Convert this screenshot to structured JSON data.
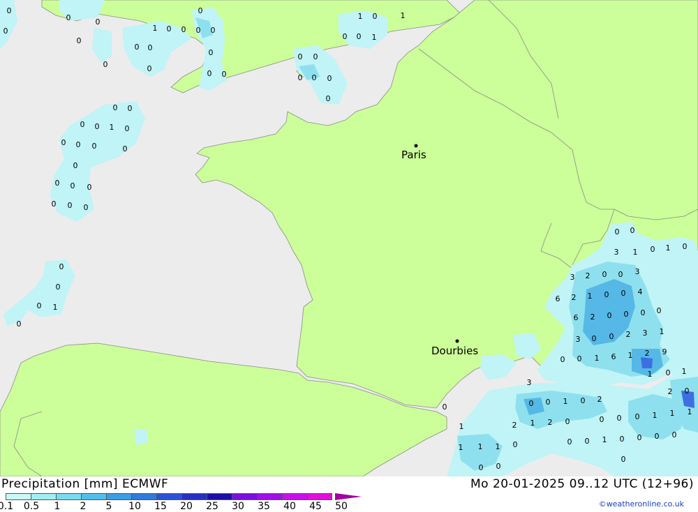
{
  "header": {
    "title_left": "Precipitation [mm] ECMWF",
    "title_right": "Mo 20-01-2025 09..12 UTC (12+96)"
  },
  "credit": "©weatheronline.co.uk",
  "colors": {
    "sea": "#ececec",
    "land": "#ccff99",
    "border": "#8a8a8a",
    "precip_light": "#c0f4f6",
    "precip_medium": "#8fe0ee",
    "precip_high": "#55b8e6",
    "precip_peak": "#3d6fe0"
  },
  "legend": {
    "ticks": [
      "0.1",
      "0.5",
      "1",
      "2",
      "5",
      "10",
      "15",
      "20",
      "25",
      "30",
      "35",
      "40",
      "45",
      "50"
    ],
    "colors": [
      "#c8f8f8",
      "#a0eef2",
      "#78dcee",
      "#50c0ea",
      "#3a9ee4",
      "#2f7ade",
      "#2b52d6",
      "#2630c4",
      "#1c10a8",
      "#7a10e0",
      "#a010e8",
      "#c810e8",
      "#e010d8"
    ]
  },
  "cities": [
    {
      "name": "Paris"
    },
    {
      "name": "Dourbies"
    }
  ],
  "precip_labels": [
    "0",
    "0",
    "0",
    "0",
    "0",
    "0",
    "1",
    "0",
    "0",
    "0",
    "0",
    "0",
    "0",
    "0",
    "0",
    "0",
    "0",
    "0",
    "1",
    "0",
    "1",
    "0",
    "0",
    "1",
    "0",
    "0",
    "0",
    "0",
    "0",
    "0",
    "0",
    "0",
    "0",
    "0",
    "1",
    "0",
    "0",
    "0",
    "0",
    "0",
    "0",
    "0",
    "0",
    "0",
    "0",
    "0",
    "0",
    "0",
    "0",
    "0",
    "1",
    "0",
    "0",
    "0",
    "0",
    "1",
    "0",
    "1",
    "3",
    "3",
    "2",
    "0",
    "0",
    "3",
    "6",
    "2",
    "1",
    "0",
    "0",
    "4",
    "6",
    "2",
    "0",
    "0",
    "0",
    "0",
    "3",
    "0",
    "0",
    "2",
    "3",
    "1",
    "0",
    "0",
    "1",
    "6",
    "1",
    "2",
    "9",
    "3",
    "1",
    "0",
    "1",
    "2",
    "0",
    "1",
    "1",
    "0",
    "0",
    "0",
    "1",
    "0",
    "2",
    "1",
    "2",
    "1",
    "2",
    "0",
    "0",
    "0",
    "0",
    "1",
    "1",
    "1",
    "1",
    "0",
    "0",
    "0",
    "1",
    "0",
    "0",
    "0",
    "0",
    "0",
    "0",
    "0"
  ]
}
